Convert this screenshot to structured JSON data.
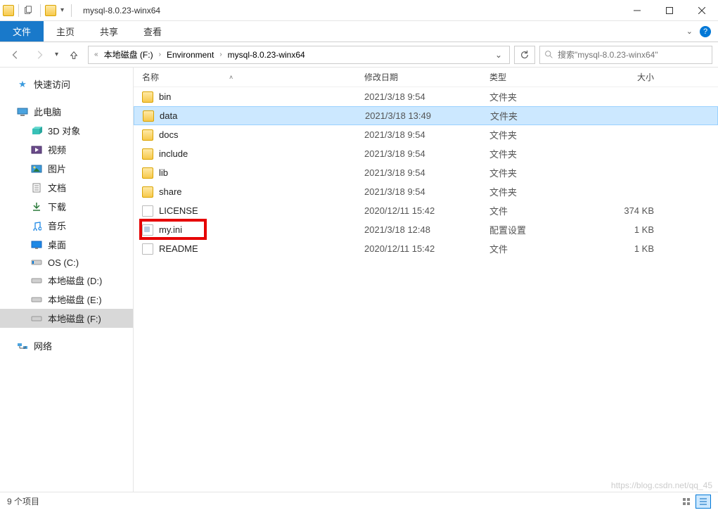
{
  "titlebar": {
    "title": "mysql-8.0.23-winx64"
  },
  "ribbon": {
    "file": "文件",
    "tabs": [
      "主页",
      "共享",
      "查看"
    ]
  },
  "address": {
    "segments": [
      "本地磁盘 (F:)",
      "Environment",
      "mysql-8.0.23-winx64"
    ],
    "search_placeholder": "搜索\"mysql-8.0.23-winx64\""
  },
  "nav": {
    "quick_access": "快速访问",
    "this_pc": "此电脑",
    "pc_items": [
      "3D 对象",
      "视频",
      "图片",
      "文档",
      "下载",
      "音乐",
      "桌面",
      "OS (C:)",
      "本地磁盘 (D:)",
      "本地磁盘 (E:)",
      "本地磁盘 (F:)"
    ],
    "network": "网络"
  },
  "columns": {
    "name": "名称",
    "date": "修改日期",
    "type": "类型",
    "size": "大小"
  },
  "files": [
    {
      "name": "bin",
      "date": "2021/3/18 9:54",
      "type": "文件夹",
      "size": "",
      "icon": "folder"
    },
    {
      "name": "data",
      "date": "2021/3/18 13:49",
      "type": "文件夹",
      "size": "",
      "icon": "folder",
      "selected": true
    },
    {
      "name": "docs",
      "date": "2021/3/18 9:54",
      "type": "文件夹",
      "size": "",
      "icon": "folder"
    },
    {
      "name": "include",
      "date": "2021/3/18 9:54",
      "type": "文件夹",
      "size": "",
      "icon": "folder"
    },
    {
      "name": "lib",
      "date": "2021/3/18 9:54",
      "type": "文件夹",
      "size": "",
      "icon": "folder"
    },
    {
      "name": "share",
      "date": "2021/3/18 9:54",
      "type": "文件夹",
      "size": "",
      "icon": "folder"
    },
    {
      "name": "LICENSE",
      "date": "2020/12/11 15:42",
      "type": "文件",
      "size": "374 KB",
      "icon": "file"
    },
    {
      "name": "my.ini",
      "date": "2021/3/18 12:48",
      "type": "配置设置",
      "size": "1 KB",
      "icon": "ini",
      "highlighted": true
    },
    {
      "name": "README",
      "date": "2020/12/11 15:42",
      "type": "文件",
      "size": "1 KB",
      "icon": "file"
    }
  ],
  "status": {
    "count": "9 个项目"
  },
  "watermark": "https://blog.csdn.net/qq_45"
}
